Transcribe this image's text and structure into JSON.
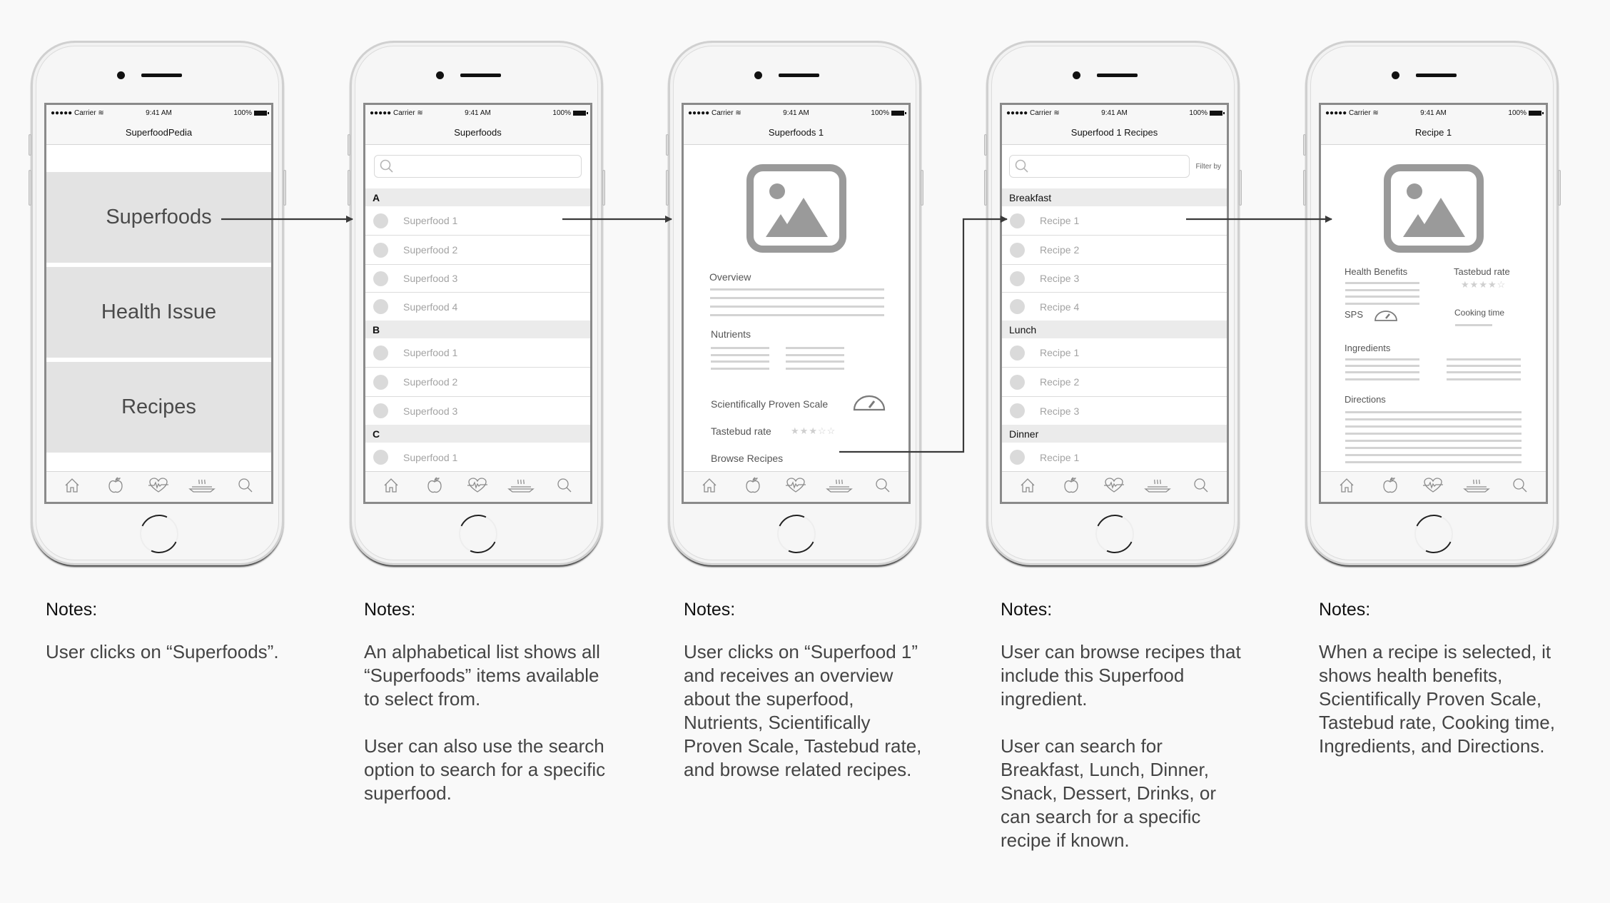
{
  "status_bar": {
    "carrier": "Carrier",
    "time": "9:41 AM",
    "battery": "100%"
  },
  "tab_icons": [
    "home-icon",
    "apple-icon",
    "heartbeat-icon",
    "hot-dish-icon",
    "search-icon"
  ],
  "screens": [
    {
      "title": "SuperfoodPedia",
      "tiles": [
        "Superfoods",
        "Health Issue",
        "Recipes"
      ]
    },
    {
      "title": "Superfoods",
      "search_placeholder": "",
      "sections": [
        {
          "header": "A",
          "items": [
            "Superfood 1",
            "Superfood 2",
            "Superfood 3",
            "Superfood 4"
          ]
        },
        {
          "header": "B",
          "items": [
            "Superfood 1",
            "Superfood 2",
            "Superfood 3"
          ]
        },
        {
          "header": "C",
          "items": [
            "Superfood 1"
          ]
        }
      ]
    },
    {
      "title": "Superfoods 1",
      "overview_label": "Overview",
      "nutrients_label": "Nutrients",
      "sps_label": "Scientifically Proven Scale",
      "tastebud_label": "Tastebud rate",
      "tastebud_rating": 3,
      "tastebud_max": 5,
      "browse_label": "Browse Recipes"
    },
    {
      "title": "Superfood 1 Recipes",
      "search_placeholder": "",
      "filter_label": "Filter by",
      "sections": [
        {
          "header": "Breakfast",
          "items": [
            "Recipe 1",
            "Recipe 2",
            "Recipe 3",
            "Recipe 4"
          ]
        },
        {
          "header": "Lunch",
          "items": [
            "Recipe 1",
            "Recipe 2",
            "Recipe 3"
          ]
        },
        {
          "header": "Dinner",
          "items": [
            "Recipe 1"
          ]
        }
      ]
    },
    {
      "title": "Recipe 1",
      "health_label": "Health Benefits",
      "tastebud_label": "Tastebud rate",
      "tastebud_rating": 4,
      "tastebud_max": 5,
      "sps_label": "SPS",
      "cooking_label": "Cooking time",
      "ingredients_label": "Ingredients",
      "directions_label": "Directions"
    }
  ],
  "notes": [
    {
      "title": "Notes:",
      "paragraphs": [
        "User clicks on “Superfoods”."
      ]
    },
    {
      "title": "Notes:",
      "paragraphs": [
        "An alphabetical list shows all “Superfoods” items available to select from.",
        "User can also use the search option to search for a specific superfood."
      ]
    },
    {
      "title": "Notes:",
      "paragraphs": [
        "User clicks on “Superfood 1” and receives an overview about the superfood, Nutrients, Scientifically Proven Scale, Tastebud rate, and browse related recipes."
      ]
    },
    {
      "title": "Notes:",
      "paragraphs": [
        "User can browse recipes that include this Superfood ingredient.",
        "User can search for Breakfast, Lunch, Dinner, Snack, Dessert, Drinks, or can search for a specific recipe if known."
      ]
    },
    {
      "title": "Notes:",
      "paragraphs": [
        "When a recipe is selected, it shows health benefits, Scientifically Proven Scale, Tastebud rate, Cooking time, Ingredients, and Directions."
      ]
    }
  ],
  "flow": [
    {
      "from": "Superfoods",
      "to": "Superfoods list"
    },
    {
      "from": "Superfood 1",
      "to": "Superfoods 1 detail"
    },
    {
      "from": "Browse Recipes",
      "to": "Superfood 1 Recipes"
    },
    {
      "from": "Recipe 1",
      "to": "Recipe 1 detail"
    }
  ]
}
